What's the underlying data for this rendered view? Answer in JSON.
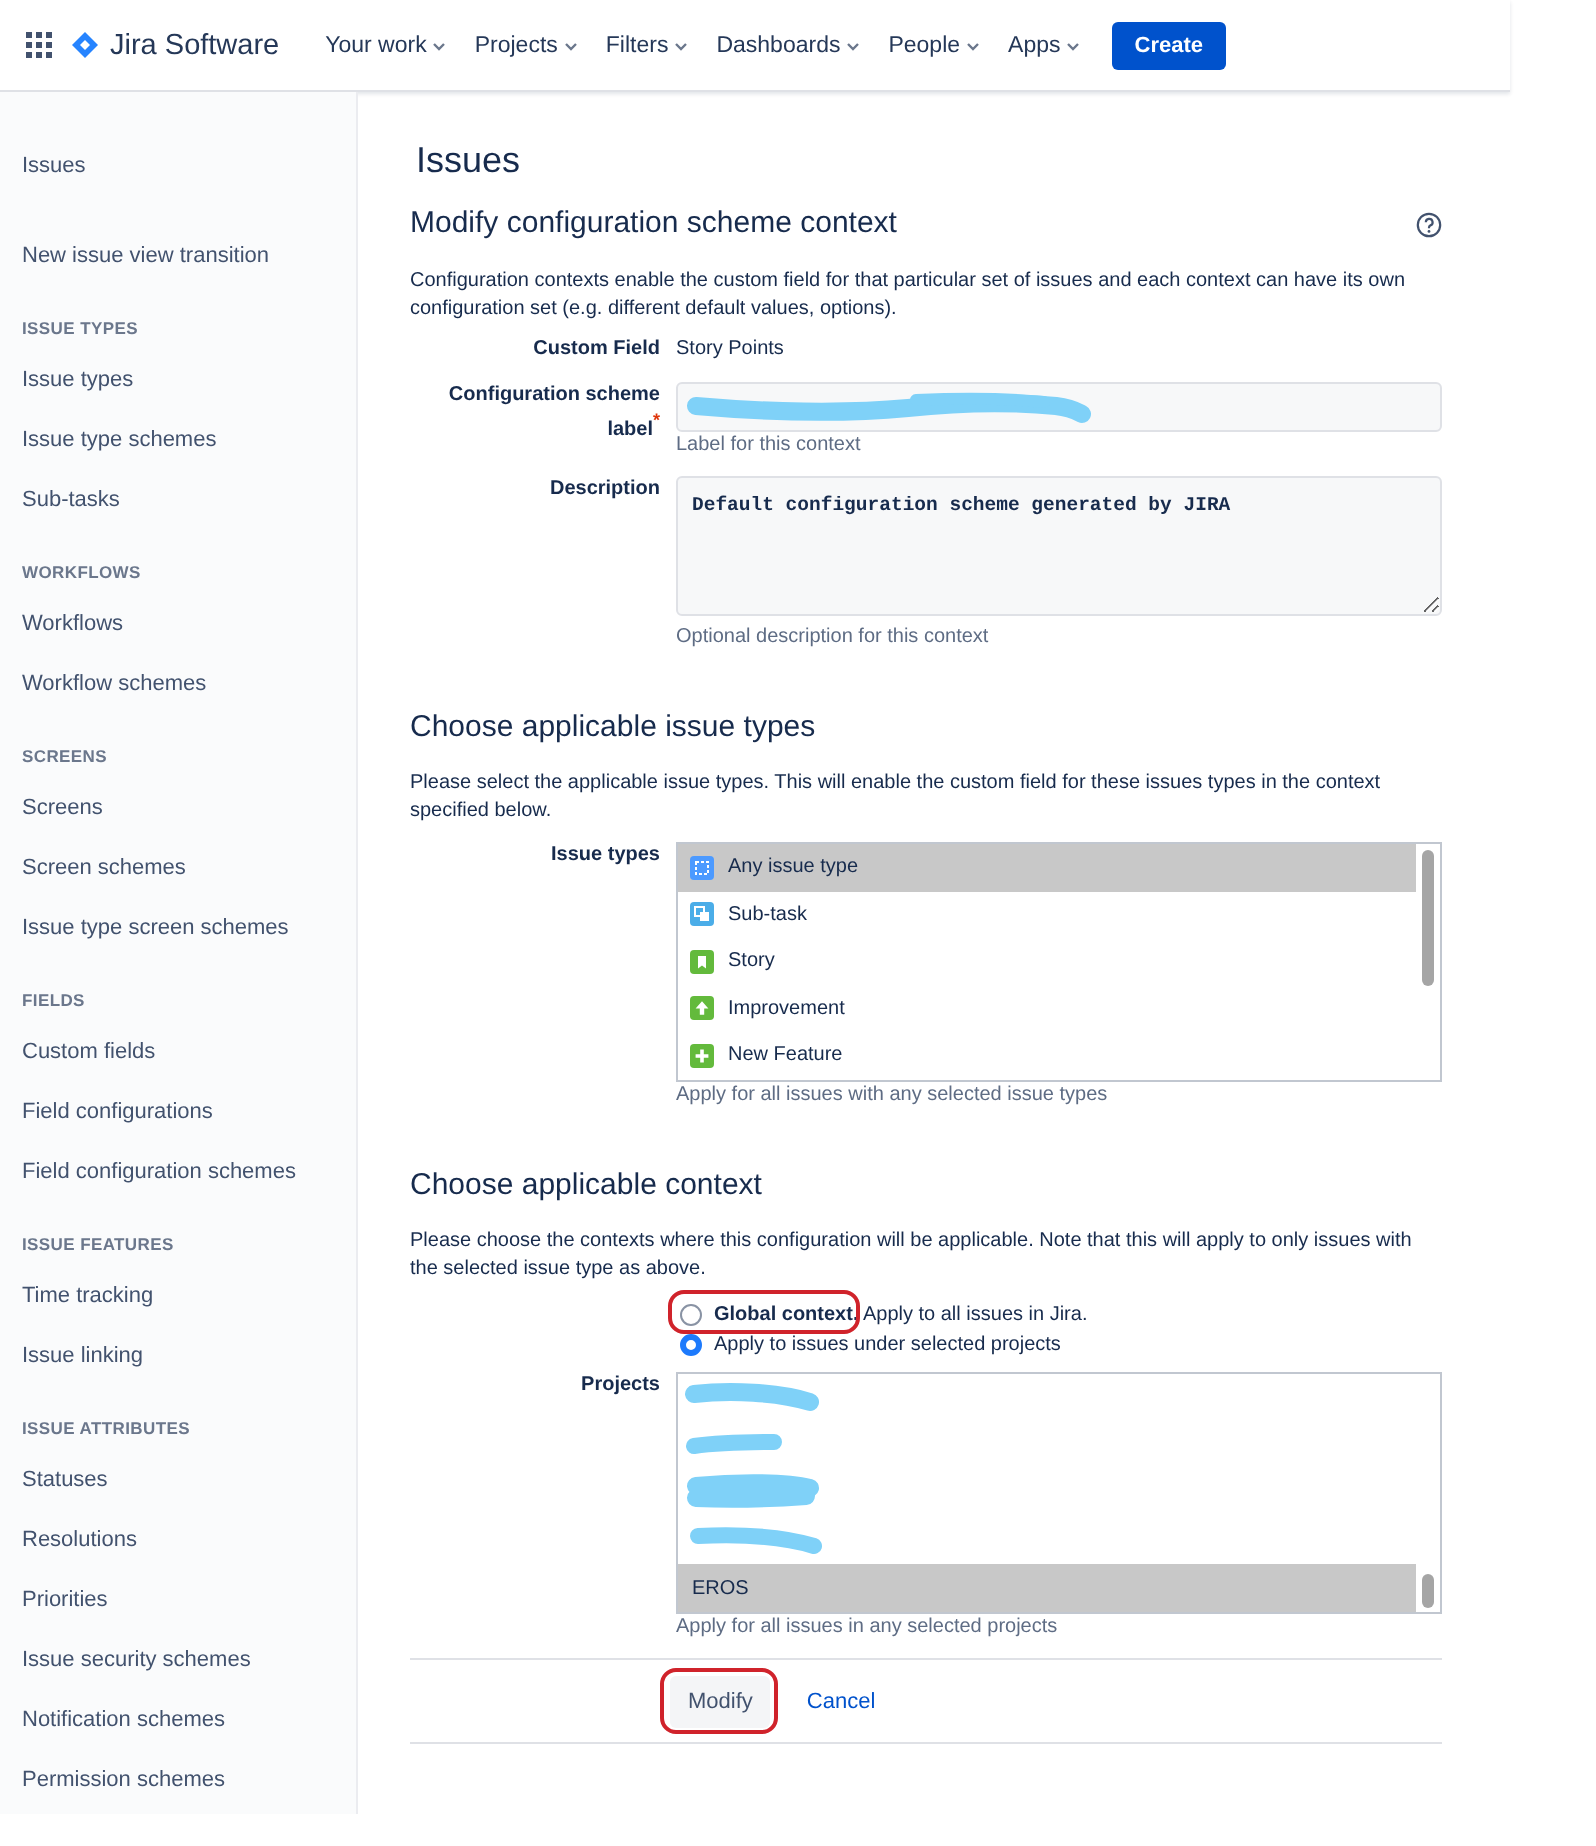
{
  "top_nav": {
    "product": "Jira Software",
    "items": [
      {
        "label": "Your work",
        "has_menu": true
      },
      {
        "label": "Projects",
        "has_menu": true
      },
      {
        "label": "Filters",
        "has_menu": true
      },
      {
        "label": "Dashboards",
        "has_menu": true
      },
      {
        "label": "People",
        "has_menu": true
      },
      {
        "label": "Apps",
        "has_menu": true
      }
    ],
    "create_button": "Create"
  },
  "sidebar": {
    "title": "Issues",
    "links": [
      "New issue view transition"
    ],
    "sections": [
      {
        "heading": "ISSUE TYPES",
        "items": [
          "Issue types",
          "Issue type schemes",
          "Sub-tasks"
        ]
      },
      {
        "heading": "WORKFLOWS",
        "items": [
          "Workflows",
          "Workflow schemes"
        ]
      },
      {
        "heading": "SCREENS",
        "items": [
          "Screens",
          "Screen schemes",
          "Issue type screen schemes"
        ]
      },
      {
        "heading": "FIELDS",
        "items": [
          "Custom fields",
          "Field configurations",
          "Field configuration schemes"
        ]
      },
      {
        "heading": "ISSUE FEATURES",
        "items": [
          "Time tracking",
          "Issue linking"
        ]
      },
      {
        "heading": "ISSUE ATTRIBUTES",
        "items": [
          "Statuses",
          "Resolutions",
          "Priorities",
          "Issue security schemes",
          "Notification schemes",
          "Permission schemes"
        ]
      }
    ]
  },
  "page_title": "Issues",
  "scheme_form": {
    "title": "Modify configuration scheme context",
    "description": "Configuration contexts enable the custom field for that particular set of issues and each context can have its own configuration set (e.g. different default values, options).",
    "custom_field": {
      "label": "Custom Field",
      "value": "Story Points"
    },
    "label_field": {
      "label": "Configuration scheme label$^{*}$",
      "redacted": true,
      "hint": "Label for this context"
    },
    "description_field": {
      "label": "Description",
      "value": "Default configuration scheme generated by JIRA",
      "hint": "Optional description for this context"
    }
  },
  "issue_types_section": {
    "title": "Choose applicable issue types",
    "description": "Please select the applicable issue types. This will enable the custom field for these issues types in the context specified below.",
    "field_label": "Issue types",
    "options": [
      {
        "kind": "any",
        "label": "Any issue type",
        "selected": true
      },
      {
        "kind": "subtask",
        "label": "Sub-task",
        "selected": false
      },
      {
        "kind": "story",
        "label": "Story",
        "selected": false
      },
      {
        "kind": "improvement",
        "label": "Improvement",
        "selected": false
      },
      {
        "kind": "new-feature",
        "label": "New Feature",
        "selected": false
      }
    ],
    "hint": "Apply for all issues with any selected issue types"
  },
  "context_section": {
    "title": "Choose applicable context",
    "description": "Please choose the contexts where this configuration will be applicable. Note that this will apply to only issues with the selected issue type as above.",
    "scope_options": [
      {
        "label": "**Global context.** Apply to all issues in Jira.",
        "selected": false,
        "circled": true
      },
      {
        "label": "Apply to issues under selected projects",
        "selected": true,
        "circled": false
      }
    ],
    "projects_label": "Projects",
    "projects": [
      {
        "kind": "redacted",
        "selected": false
      },
      {
        "kind": "redacted",
        "selected": false
      },
      {
        "kind": "redacted",
        "selected": false
      },
      {
        "kind": "redacted",
        "selected": false
      },
      {
        "kind": "project",
        "label": "EROS",
        "selected": true
      }
    ],
    "hint": "Apply for all issues in any selected projects"
  },
  "actions": [
    {
      "kind": "button",
      "label": "Modify",
      "circled": true
    },
    {
      "kind": "link",
      "label": "Cancel",
      "circled": false
    }
  ]
}
